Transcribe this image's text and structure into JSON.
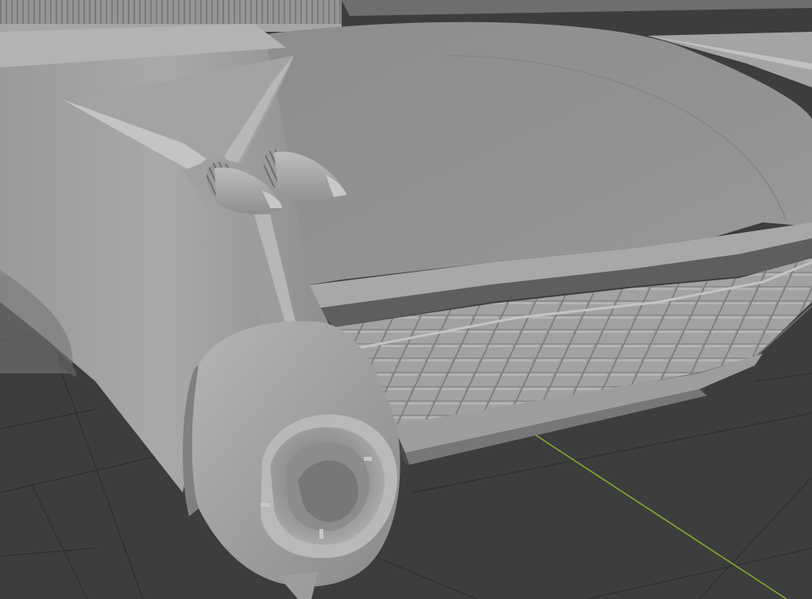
{
  "app": {
    "view": "3d-viewport",
    "shading": "solid",
    "subject": "car-rear-tailfin-model"
  },
  "colors": {
    "background": "#3d3d3d",
    "grid_line": "#2b2b2b",
    "axis_y": "#7fae2f",
    "model_light": "#a6a6a6",
    "model_mid": "#8c8c8c",
    "model_dark": "#6f6f6f",
    "model_shadow": "#575757"
  },
  "icons": []
}
